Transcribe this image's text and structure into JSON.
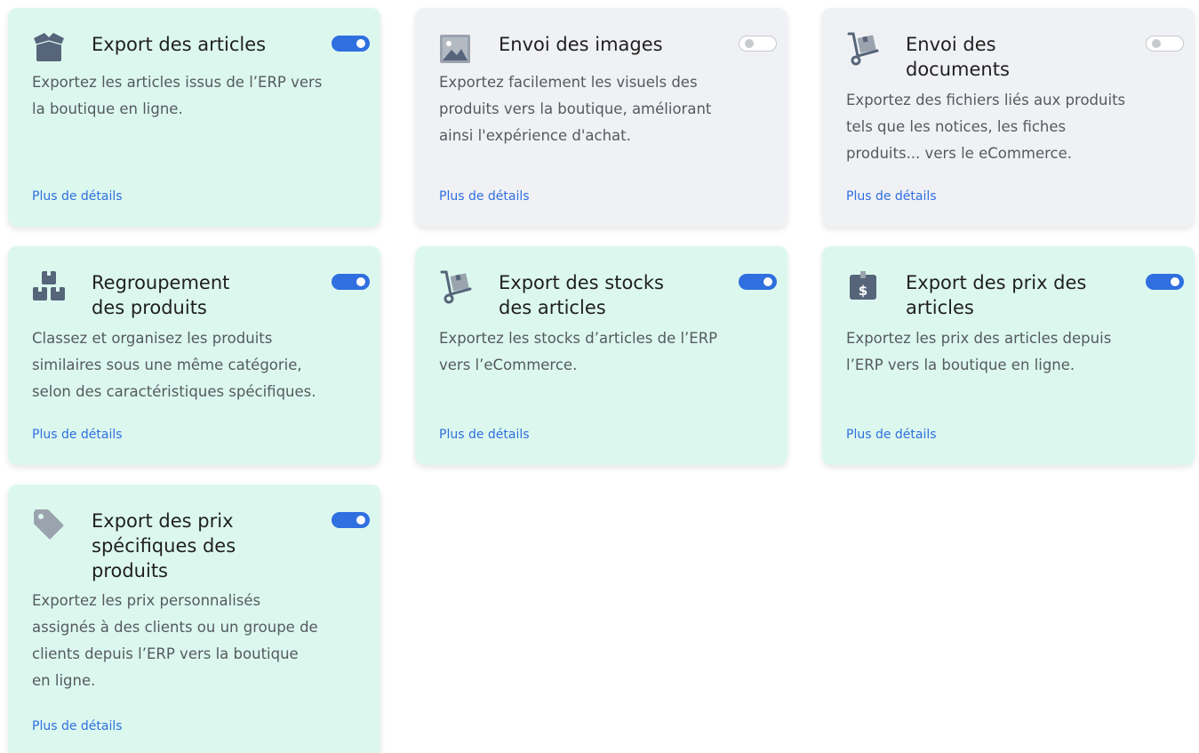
{
  "cards": [
    {
      "title": "Export des articles",
      "description": "Exportez les articles issus de l’ERP vers\nla boutique en ligne.",
      "link": "Plus de détails",
      "enabled": true,
      "icon": "box-icon"
    },
    {
      "title": "Envoi des images",
      "description": "Exportez facilement les visuels des\nproduits vers la boutique, améliorant\nainsi l'expérience d'achat.",
      "link": "Plus de détails",
      "enabled": false,
      "icon": "image-icon"
    },
    {
      "title": "Envoi des\ndocuments",
      "description": "Exportez des fichiers liés aux produits\ntels que les notices, les fiches\nproduits... vers le eCommerce.",
      "link": "Plus de détails",
      "enabled": false,
      "icon": "dolly-icon"
    },
    {
      "title": "Regroupement\ndes produits",
      "description": "Classez et organisez les produits\nsimilaires sous une même catégorie,\nselon des caractéristiques spécifiques.",
      "link": "Plus de détails",
      "enabled": true,
      "icon": "boxes-icon"
    },
    {
      "title": "Export des stocks\ndes articles",
      "description": "Exportez les stocks d’articles de l’ERP\nvers l’eCommerce.",
      "link": "Plus de détails",
      "enabled": true,
      "icon": "dolly-icon"
    },
    {
      "title": "Export des prix des\narticles",
      "description": "Exportez les prix des articles depuis\nl’ERP vers la boutique en ligne.",
      "link": "Plus de détails",
      "enabled": true,
      "icon": "dollar-box-icon"
    },
    {
      "title": "Export des prix\nspécifiques des\nproduits",
      "description": "Exportez les prix personnalisés\nassignés à des clients ou un groupe de\nclients depuis l’ERP vers la boutique\nen ligne.",
      "link": "Plus de détails",
      "enabled": true,
      "icon": "tag-icon"
    }
  ],
  "colors": {
    "card_enabled_bg": "#dcf8ee",
    "card_disabled_bg": "#f0f1f4",
    "toggle_on": "#2f6fe0",
    "link": "#2f6fe0",
    "icon": "#56657a"
  }
}
